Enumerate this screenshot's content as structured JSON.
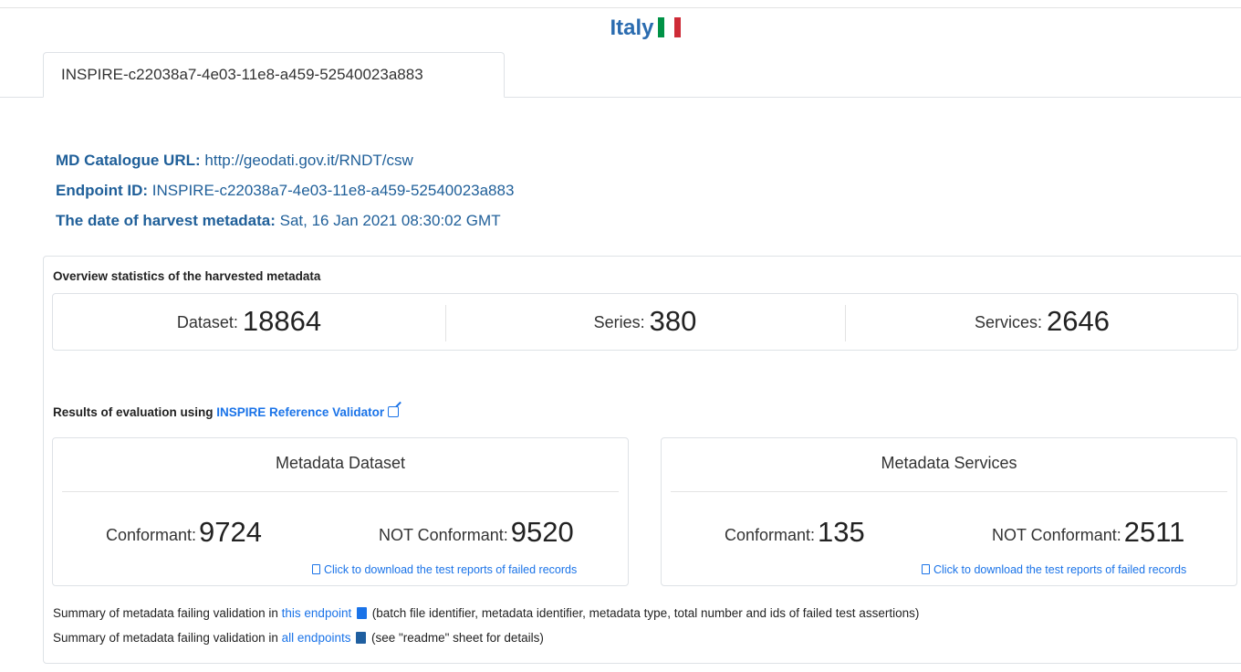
{
  "header": {
    "country": "Italy",
    "flag_colors": [
      "#009246",
      "#ffffff",
      "#ce2b37"
    ]
  },
  "tabs": [
    {
      "label": "INSPIRE-c22038a7-4e03-11e8-a459-52540023a883",
      "active": true
    }
  ],
  "info": {
    "catalogue_label": "MD Catalogue URL:",
    "catalogue_value": "http://geodati.gov.it/RNDT/csw",
    "endpoint_label": "Endpoint ID:",
    "endpoint_value": "INSPIRE-c22038a7-4e03-11e8-a459-52540023a883",
    "date_label": "The date of harvest metadata:",
    "date_value": "Sat, 16 Jan 2021 08:30:02 GMT"
  },
  "overview": {
    "title": "Overview statistics of the harvested metadata",
    "dataset_label": "Dataset:",
    "dataset_value": "18864",
    "series_label": "Series:",
    "series_value": "380",
    "services_label": "Services:",
    "services_value": "2646"
  },
  "evaluation": {
    "title_prefix": "Results of evaluation using",
    "validator_link": "INSPIRE Reference Validator",
    "dataset": {
      "title": "Metadata Dataset",
      "conformant_label": "Conformant:",
      "conformant_value": "9724",
      "not_conformant_label": "NOT Conformant:",
      "not_conformant_value": "9520",
      "download_link": "Click to download the test reports of failed records"
    },
    "services": {
      "title": "Metadata Services",
      "conformant_label": "Conformant:",
      "conformant_value": "135",
      "not_conformant_label": "NOT Conformant:",
      "not_conformant_value": "2511",
      "download_link": "Click to download the test reports of failed records"
    }
  },
  "summary": {
    "line1_prefix": "Summary of metadata failing validation in",
    "line1_link": "this endpoint",
    "line1_suffix": "(batch file identifier, metadata identifier, metadata type, total number and ids of failed test assertions)",
    "line2_prefix": "Summary of metadata failing validation in",
    "line2_link": "all endpoints",
    "line2_suffix": "(see \"readme\" sheet for details)"
  }
}
